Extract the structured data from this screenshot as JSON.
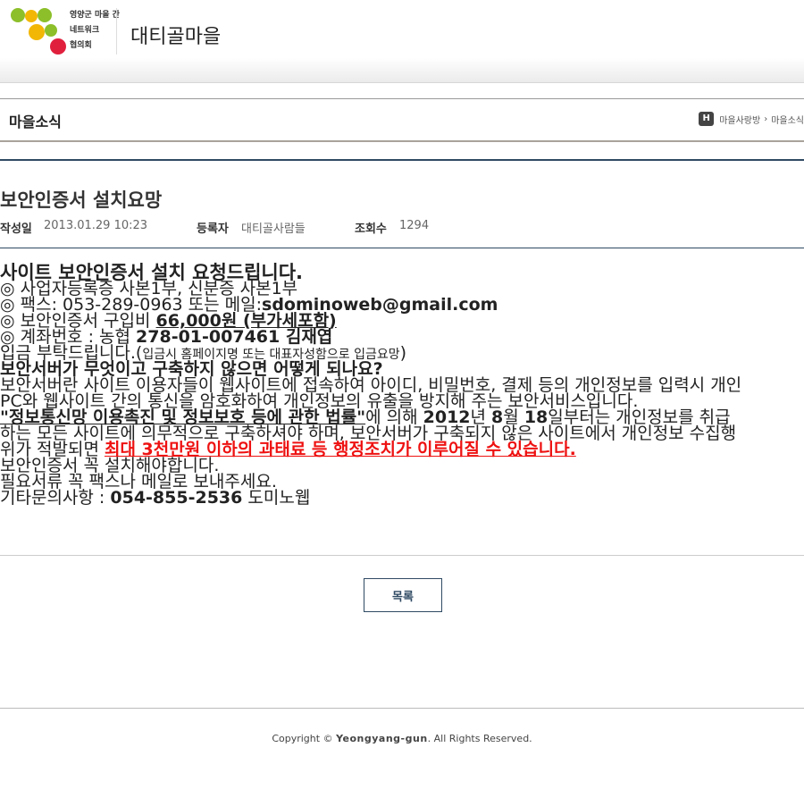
{
  "header": {
    "logo_line1": "영양군 마을 간",
    "logo_line2": "네트워크",
    "logo_line3": "협의회",
    "site_name": "대티골마을",
    "logo_colors": [
      "#8cbf2a",
      "#f2b705",
      "#f2b705",
      "#8cbf2a",
      "#e01f3d"
    ]
  },
  "breadcrumb": {
    "section_title": "마을소식",
    "home_icon": "H",
    "path_1": "마을사랑방",
    "separator": "›",
    "path_2": "마을소식"
  },
  "post": {
    "title": "보안인증서 설치요망",
    "date_label": "작성일",
    "date_value": "2013.01.29 10:23",
    "author_label": "등록자",
    "author_value": "대티골사람들",
    "views_label": "조회수",
    "views_value": "1294"
  },
  "content": {
    "l1": "사이트 보안인증서 설치 요청드립니다.",
    "l2": "◎ 사업자등록증 사본1부, 신분증 사본1부",
    "l3a": "◎ 팩스: 053-289-0963 또는 메일:",
    "l3b": "sdominoweb@gmail.com",
    "l4a": "◎ 보안인증서 구입비 ",
    "l4b": "66,000원 (부가세포함)",
    "l5a": "◎ 계좌번호 : 농협 ",
    "l5b": "278-01-007461 김재엽",
    "l6a": "입금 부탁드립니다.(",
    "l6b": "입금시 홈페이지명 또는 대표자성함으로 입금요망",
    "l6c": ")",
    "l7": "보안서버가 무엇이고 구축하지 않으면 어떻게 되나요?",
    "l8": "보안서버란 사이트 이용자들이 웹사이트에 접속하여 아이디, 비밀번호, 결제 등의 개인정보를 입력시 개인",
    "l9": "PC와 웹사이트 간의 통신을 암호화하여 개인정보의 유출을 방지해 주는 보안서비스입니다.",
    "l10a": "\"정보통신망 이용촉진 및 정보보호 등에 관한 법률\"",
    "l10b": "에 의해 ",
    "l10c": "2012",
    "l10d": "년 ",
    "l10e": "8",
    "l10f": "월 ",
    "l10g": "18",
    "l10h": "일부터는 개인정보를 취급",
    "l11": "하는 모든 사이트에 의무적으로 구축하셔야 하며, 보안서버가 구축되지 않은 사이트에서 개인정보 수집행",
    "l12a": "위가 적발되면 ",
    "l12b": "최대 3천만원 이하의 과태료 등 행정조치가 이루어질 수 있습니다.",
    "l13": "보안인증서 꼭 설치해야합니다.",
    "l14": "필요서류 꼭 팩스나 메일로 보내주세요.",
    "l15a": "기타문의사항 : ",
    "l15b": "054-855-2536",
    "l15c": " 도미노웹"
  },
  "buttons": {
    "list_label": "목록"
  },
  "footer": {
    "prefix": "Copyright © ",
    "brand": "Yeongyang-gun",
    "suffix": ". All Rights Reserved."
  }
}
